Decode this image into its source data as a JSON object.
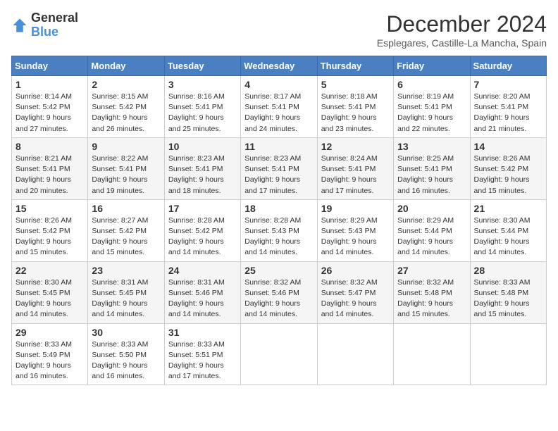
{
  "logo": {
    "text_general": "General",
    "text_blue": "Blue"
  },
  "title": "December 2024",
  "subtitle": "Esplegares, Castille-La Mancha, Spain",
  "days_of_week": [
    "Sunday",
    "Monday",
    "Tuesday",
    "Wednesday",
    "Thursday",
    "Friday",
    "Saturday"
  ],
  "weeks": [
    [
      {
        "day": "1",
        "sunrise": "8:14 AM",
        "sunset": "5:42 PM",
        "daylight": "9 hours and 27 minutes."
      },
      {
        "day": "2",
        "sunrise": "8:15 AM",
        "sunset": "5:42 PM",
        "daylight": "9 hours and 26 minutes."
      },
      {
        "day": "3",
        "sunrise": "8:16 AM",
        "sunset": "5:41 PM",
        "daylight": "9 hours and 25 minutes."
      },
      {
        "day": "4",
        "sunrise": "8:17 AM",
        "sunset": "5:41 PM",
        "daylight": "9 hours and 24 minutes."
      },
      {
        "day": "5",
        "sunrise": "8:18 AM",
        "sunset": "5:41 PM",
        "daylight": "9 hours and 23 minutes."
      },
      {
        "day": "6",
        "sunrise": "8:19 AM",
        "sunset": "5:41 PM",
        "daylight": "9 hours and 22 minutes."
      },
      {
        "day": "7",
        "sunrise": "8:20 AM",
        "sunset": "5:41 PM",
        "daylight": "9 hours and 21 minutes."
      }
    ],
    [
      {
        "day": "8",
        "sunrise": "8:21 AM",
        "sunset": "5:41 PM",
        "daylight": "9 hours and 20 minutes."
      },
      {
        "day": "9",
        "sunrise": "8:22 AM",
        "sunset": "5:41 PM",
        "daylight": "9 hours and 19 minutes."
      },
      {
        "day": "10",
        "sunrise": "8:23 AM",
        "sunset": "5:41 PM",
        "daylight": "9 hours and 18 minutes."
      },
      {
        "day": "11",
        "sunrise": "8:23 AM",
        "sunset": "5:41 PM",
        "daylight": "9 hours and 17 minutes."
      },
      {
        "day": "12",
        "sunrise": "8:24 AM",
        "sunset": "5:41 PM",
        "daylight": "9 hours and 17 minutes."
      },
      {
        "day": "13",
        "sunrise": "8:25 AM",
        "sunset": "5:41 PM",
        "daylight": "9 hours and 16 minutes."
      },
      {
        "day": "14",
        "sunrise": "8:26 AM",
        "sunset": "5:42 PM",
        "daylight": "9 hours and 15 minutes."
      }
    ],
    [
      {
        "day": "15",
        "sunrise": "8:26 AM",
        "sunset": "5:42 PM",
        "daylight": "9 hours and 15 minutes."
      },
      {
        "day": "16",
        "sunrise": "8:27 AM",
        "sunset": "5:42 PM",
        "daylight": "9 hours and 15 minutes."
      },
      {
        "day": "17",
        "sunrise": "8:28 AM",
        "sunset": "5:42 PM",
        "daylight": "9 hours and 14 minutes."
      },
      {
        "day": "18",
        "sunrise": "8:28 AM",
        "sunset": "5:43 PM",
        "daylight": "9 hours and 14 minutes."
      },
      {
        "day": "19",
        "sunrise": "8:29 AM",
        "sunset": "5:43 PM",
        "daylight": "9 hours and 14 minutes."
      },
      {
        "day": "20",
        "sunrise": "8:29 AM",
        "sunset": "5:44 PM",
        "daylight": "9 hours and 14 minutes."
      },
      {
        "day": "21",
        "sunrise": "8:30 AM",
        "sunset": "5:44 PM",
        "daylight": "9 hours and 14 minutes."
      }
    ],
    [
      {
        "day": "22",
        "sunrise": "8:30 AM",
        "sunset": "5:45 PM",
        "daylight": "9 hours and 14 minutes."
      },
      {
        "day": "23",
        "sunrise": "8:31 AM",
        "sunset": "5:45 PM",
        "daylight": "9 hours and 14 minutes."
      },
      {
        "day": "24",
        "sunrise": "8:31 AM",
        "sunset": "5:46 PM",
        "daylight": "9 hours and 14 minutes."
      },
      {
        "day": "25",
        "sunrise": "8:32 AM",
        "sunset": "5:46 PM",
        "daylight": "9 hours and 14 minutes."
      },
      {
        "day": "26",
        "sunrise": "8:32 AM",
        "sunset": "5:47 PM",
        "daylight": "9 hours and 14 minutes."
      },
      {
        "day": "27",
        "sunrise": "8:32 AM",
        "sunset": "5:48 PM",
        "daylight": "9 hours and 15 minutes."
      },
      {
        "day": "28",
        "sunrise": "8:33 AM",
        "sunset": "5:48 PM",
        "daylight": "9 hours and 15 minutes."
      }
    ],
    [
      {
        "day": "29",
        "sunrise": "8:33 AM",
        "sunset": "5:49 PM",
        "daylight": "9 hours and 16 minutes."
      },
      {
        "day": "30",
        "sunrise": "8:33 AM",
        "sunset": "5:50 PM",
        "daylight": "9 hours and 16 minutes."
      },
      {
        "day": "31",
        "sunrise": "8:33 AM",
        "sunset": "5:51 PM",
        "daylight": "9 hours and 17 minutes."
      },
      null,
      null,
      null,
      null
    ]
  ]
}
